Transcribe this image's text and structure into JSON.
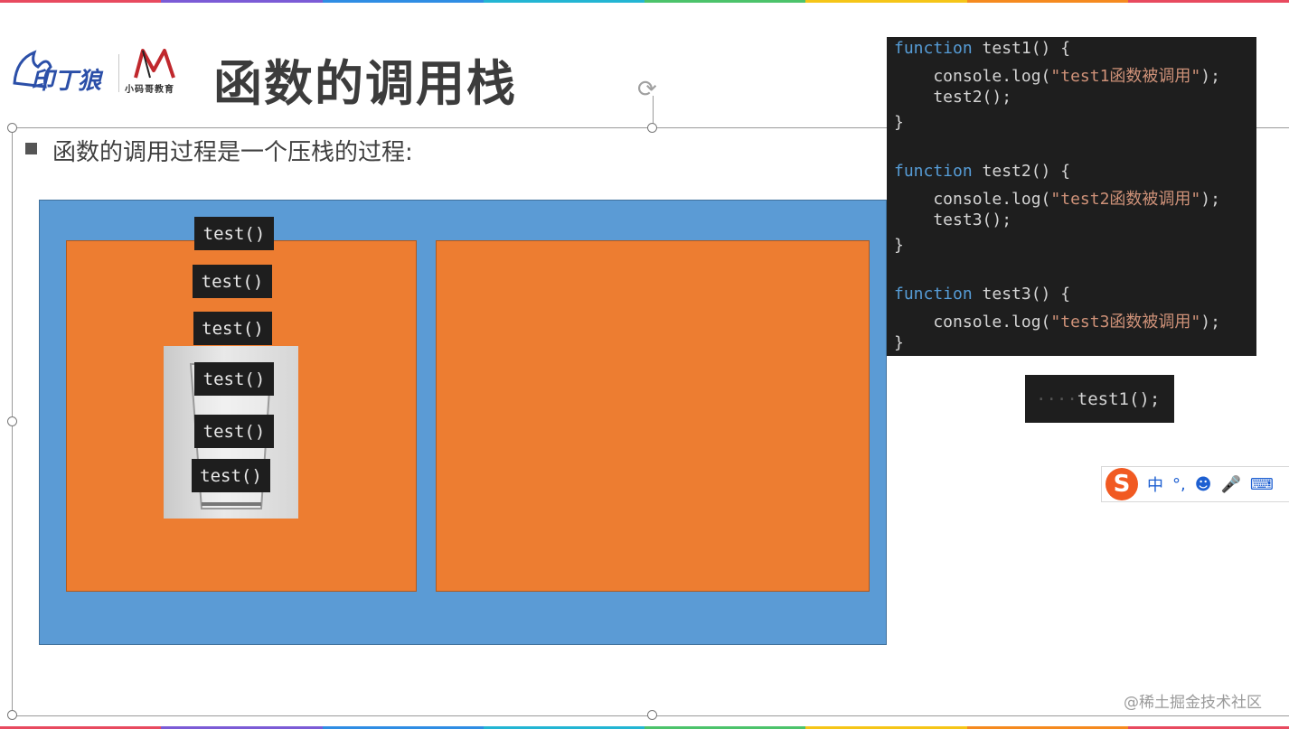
{
  "slide": {
    "title": "函数的调用栈",
    "bullet": "函数的调用过程是一个压栈的过程:",
    "logo_wolf_text": "印丁狼",
    "logo_m_text": "小码哥教育"
  },
  "stack_tags": [
    "test()",
    "test()",
    "test()",
    "test()",
    "test()",
    "test()"
  ],
  "code": {
    "lines": [
      {
        "kw": "function",
        "rest": " test1() {"
      },
      {
        "pre": "    console.log(",
        "str": "\"test1函数被调用\"",
        "post": ");"
      },
      {
        "pre": "    test2();"
      },
      {
        "pre": "}"
      },
      {
        "pre": ""
      },
      {
        "kw": "function",
        "rest": " test2() {"
      },
      {
        "pre": "    console.log(",
        "str": "\"test2函数被调用\"",
        "post": ");"
      },
      {
        "pre": "    test3();"
      },
      {
        "pre": "}"
      },
      {
        "pre": ""
      },
      {
        "kw": "function",
        "rest": " test3() {"
      },
      {
        "pre": "    console.log(",
        "str": "\"test3函数被调用\"",
        "post": ");"
      },
      {
        "pre": "}"
      }
    ],
    "call": "test1();"
  },
  "ime": {
    "logo": "S",
    "items": [
      "中",
      "°,",
      "☻",
      "🎤",
      "⌨"
    ]
  },
  "watermark": "@稀土掘金技术社区",
  "colors": {
    "blue": "#5b9bd5",
    "orange": "#ed7d31",
    "code_bg": "#1e1e1e",
    "keyword": "#569cd6",
    "string": "#ce9178"
  }
}
